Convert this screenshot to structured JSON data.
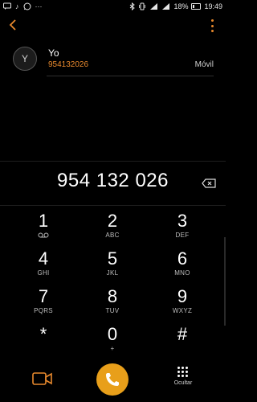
{
  "status_bar": {
    "battery": "18%",
    "time": "19:49"
  },
  "contact": {
    "avatar_initial": "Y",
    "name": "Yo",
    "number": "954132026",
    "type": "Móvil"
  },
  "dialer": {
    "number": "954 132 026"
  },
  "keypad": {
    "keys": [
      {
        "digit": "1",
        "sub": ""
      },
      {
        "digit": "2",
        "sub": "ABC"
      },
      {
        "digit": "3",
        "sub": "DEF"
      },
      {
        "digit": "4",
        "sub": "GHI"
      },
      {
        "digit": "5",
        "sub": "JKL"
      },
      {
        "digit": "6",
        "sub": "MNO"
      },
      {
        "digit": "7",
        "sub": "PQRS"
      },
      {
        "digit": "8",
        "sub": "TUV"
      },
      {
        "digit": "9",
        "sub": "WXYZ"
      },
      {
        "digit": "*",
        "sub": ""
      },
      {
        "digit": "0",
        "sub": "+"
      },
      {
        "digit": "#",
        "sub": ""
      }
    ]
  },
  "bottom_bar": {
    "hide_label": "Ocultar"
  },
  "colors": {
    "accent": "#e8892d",
    "call_button": "#e89f1a",
    "background": "#000000"
  }
}
